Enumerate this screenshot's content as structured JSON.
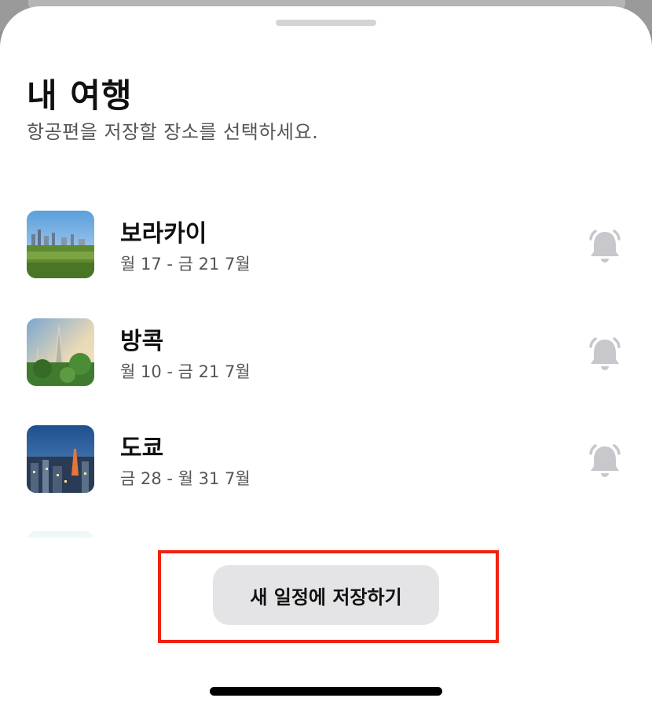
{
  "header": {
    "title": "내 여행",
    "subtitle": "항공편을 저장할 장소를 선택하세요."
  },
  "trips": [
    {
      "name": "보라카이",
      "dates": "월 17 - 금 21 7월",
      "icon": "bell-icon"
    },
    {
      "name": "방콕",
      "dates": "월 10 - 금 21 7월",
      "icon": "bell-icon"
    },
    {
      "name": "도쿄",
      "dates": "금 28 - 월 31 7월",
      "icon": "bell-icon"
    }
  ],
  "save_button": {
    "label": "새 일정에 저장하기"
  },
  "colors": {
    "highlight": "#f0210f",
    "button_bg": "#e4e4e6",
    "bell": "#c7c7cc"
  }
}
